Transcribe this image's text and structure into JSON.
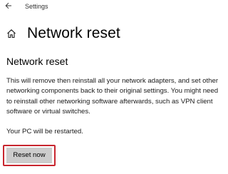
{
  "titlebar": {
    "back_icon": "back-arrow-icon",
    "app_title": "Settings"
  },
  "header": {
    "home_icon": "home-icon",
    "title": "Network reset"
  },
  "content": {
    "section_title": "Network reset",
    "description": "This will remove then reinstall all your network adapters, and set other networking components back to their original settings. You might need to reinstall other networking software afterwards, such as VPN client software or virtual switches.",
    "restart_note": "Your PC will be restarted.",
    "reset_button_label": "Reset now"
  },
  "colors": {
    "highlight_border": "#c8262f",
    "button_background": "#cccccc"
  }
}
